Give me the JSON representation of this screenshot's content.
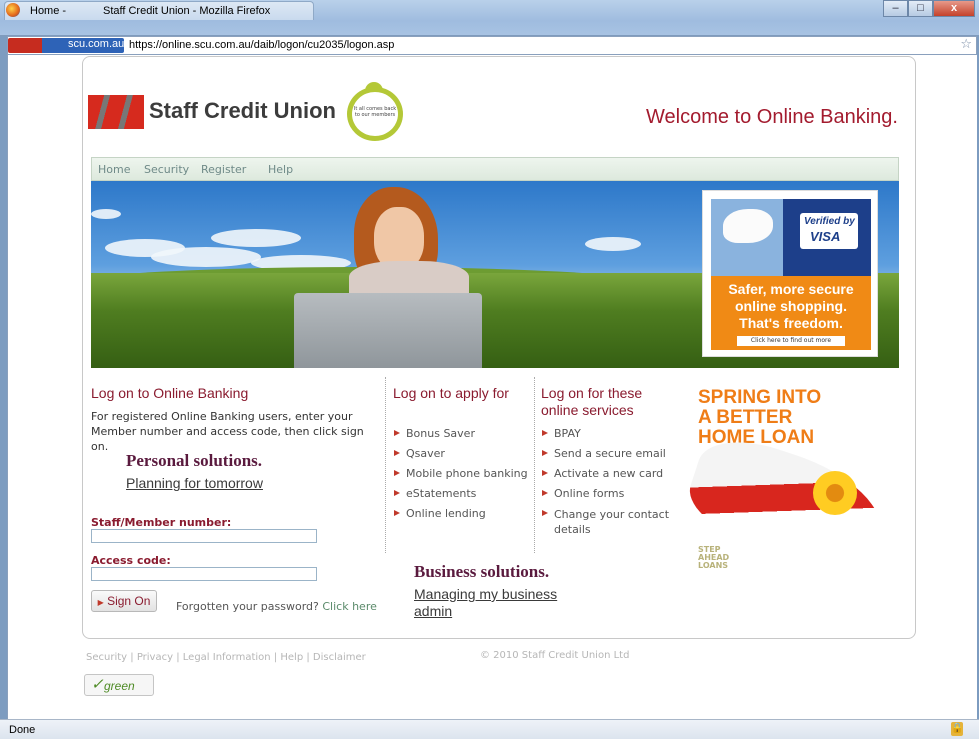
{
  "window": {
    "tab_label": "Home -",
    "title": "Staff Credit Union - Mozilla Firefox",
    "min_label": "–",
    "max_label": "□",
    "close_label": "x"
  },
  "urlbar": {
    "site_identity": "scu.com.au",
    "url": "https://online.scu.com.au/daib/logon/cu2035/logon.asp"
  },
  "header": {
    "brand": "Staff Credit Union",
    "badge_text": "It all comes back to our members",
    "welcome": "Welcome to Online Banking."
  },
  "nav": [
    "Home",
    "Security",
    "Register",
    "Help"
  ],
  "hero_ad": {
    "verified_line1": "Verified by",
    "verified_line2": "VISA",
    "line1": "Safer, more secure",
    "line2": "online shopping.",
    "line3": "That's freedom.",
    "cta": "Click here to find out more"
  },
  "logon": {
    "title": "Log on to Online Banking",
    "intro": "For registered Online Banking users, enter your Member number and access code, then click sign on.",
    "personal_heading": "Personal solutions.",
    "personal_link": "Planning for tomorrow",
    "member_label": "Staff/Member number:",
    "access_label": "Access code:",
    "member_value": "",
    "access_value": "",
    "sign_on": "Sign On",
    "forgot_text": "Forgotten your password?",
    "forgot_link": "Click here"
  },
  "apply": {
    "title": "Log on to apply for",
    "items": [
      "Bonus Saver",
      "Qsaver",
      "Mobile phone banking",
      "eStatements",
      "Online lending"
    ]
  },
  "services": {
    "title": "Log on for these online services",
    "items": [
      "BPAY",
      "Send a secure email",
      "Activate a new card",
      "Online forms",
      "Change your contact details"
    ]
  },
  "business": {
    "heading": "Business solutions.",
    "link": "Managing my business admin"
  },
  "loan_ad": {
    "line1": "SPRING INTO",
    "line2": "A BETTER",
    "line3": "HOME LOAN",
    "step": "STEP AHEAD LOANS"
  },
  "footer": {
    "links": [
      "Security",
      "Privacy",
      "Legal Information",
      "Help",
      "Disclaimer"
    ],
    "copyright": "© 2010 Staff Credit Union Ltd",
    "green": "green"
  },
  "status": {
    "text": "Done"
  },
  "colors": {
    "brand_red": "#a31b2e",
    "heading_maroon": "#8a1b2f",
    "loan_orange": "#ef7d17",
    "visa_orange": "#f08a15"
  }
}
